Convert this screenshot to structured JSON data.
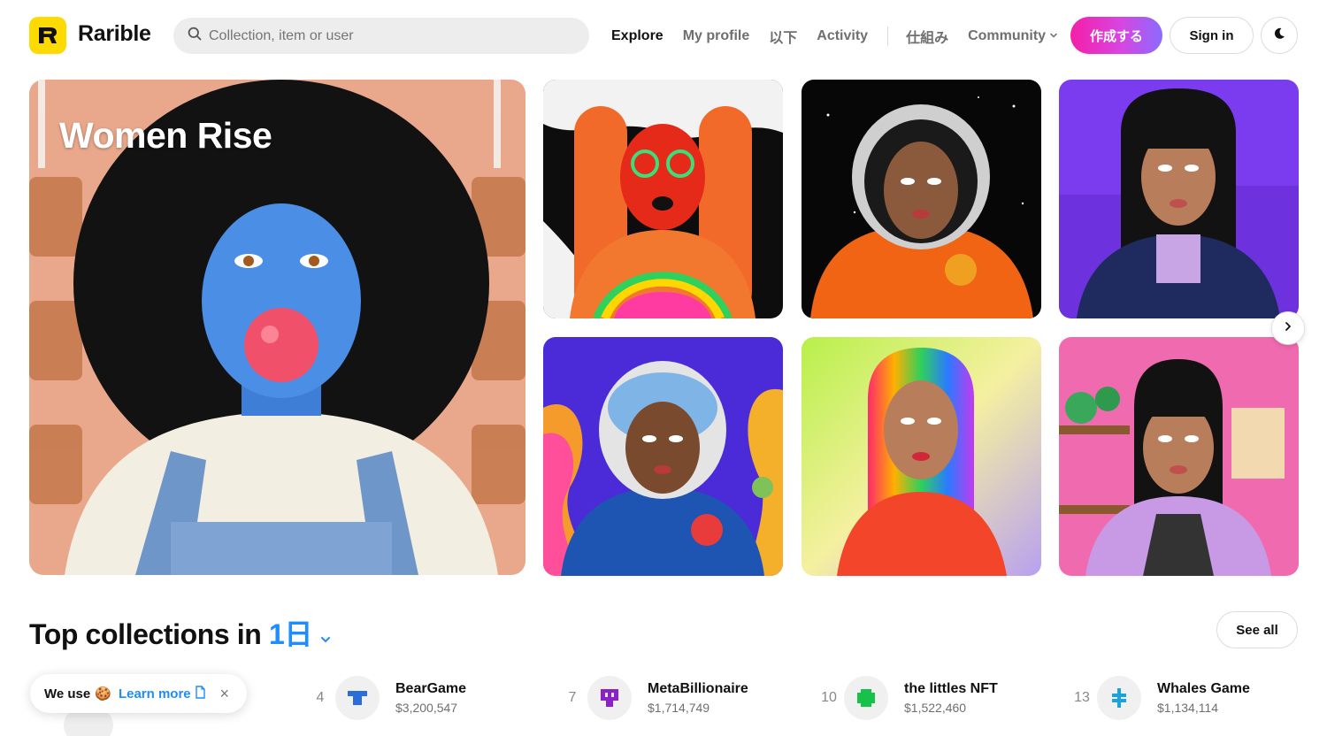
{
  "header": {
    "brand": "Rarible",
    "search_placeholder": "Collection, item or user",
    "nav": [
      {
        "label": "Explore",
        "active": true
      },
      {
        "label": "My profile"
      },
      {
        "label": "以下"
      },
      {
        "label": "Activity"
      },
      {
        "label": "仕組み"
      },
      {
        "label": "Community",
        "dropdown": true
      }
    ],
    "create_label": "作成する",
    "signin_label": "Sign in",
    "theme_icon": "moon-icon"
  },
  "hero": {
    "title": "Women Rise"
  },
  "gallery": {
    "tiles": [
      {
        "name": "red-haired-woman-artwork"
      },
      {
        "name": "astronaut-orange-suit-artwork"
      },
      {
        "name": "purple-jacket-woman-artwork"
      },
      {
        "name": "astronaut-blue-suit-artwork"
      },
      {
        "name": "rainbow-hair-woman-artwork"
      },
      {
        "name": "plants-room-woman-artwork"
      }
    ],
    "next_icon": "chevron-right-icon"
  },
  "top_collections": {
    "title_prefix": "Top collections in ",
    "period": "1日",
    "see_all_label": "See all",
    "items": [
      {
        "rank": "4",
        "name": "BearGame",
        "volume": "$3,200,547",
        "icon_color": "#2b6ed9"
      },
      {
        "rank": "7",
        "name": "MetaBillionaire",
        "volume": "$1,714,749",
        "icon_color": "#8b22c9"
      },
      {
        "rank": "10",
        "name": "the littles NFT",
        "volume": "$1,522,460",
        "icon_color": "#17c24a"
      },
      {
        "rank": "13",
        "name": "Whales Game",
        "volume": "$1,134,114",
        "icon_color": "#1aa3d9"
      }
    ]
  },
  "cookie": {
    "text": "We use",
    "emoji": "🍪",
    "learn_more": "Learn more",
    "close": "×"
  }
}
